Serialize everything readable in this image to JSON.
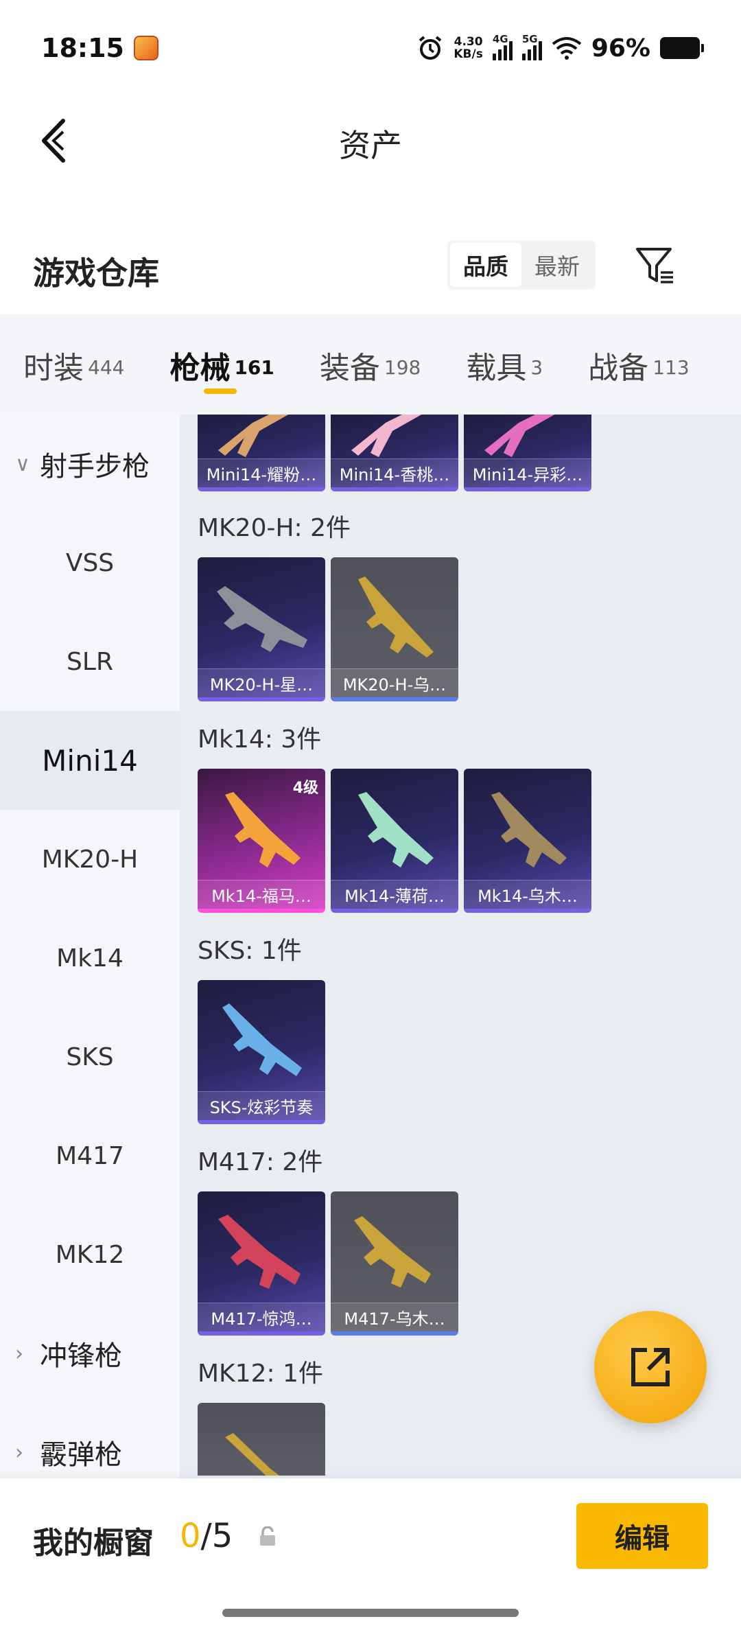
{
  "status": {
    "time": "18:15",
    "speed_value": "4.30",
    "speed_unit": "KB/s",
    "sig1": "4G",
    "sig2": "5G",
    "battery": "96%"
  },
  "nav": {
    "title": "资产"
  },
  "warehouse": {
    "title": "游戏仓库",
    "sort_quality": "品质",
    "sort_latest": "最新"
  },
  "tabs": [
    {
      "name": "时装",
      "count": "444"
    },
    {
      "name": "枪械",
      "count": "161"
    },
    {
      "name": "装备",
      "count": "198"
    },
    {
      "name": "载具",
      "count": "3"
    },
    {
      "name": "战备",
      "count": "113"
    }
  ],
  "sidebar": {
    "group_marksman": "射手步枪",
    "items": [
      "VSS",
      "SLR",
      "Mini14",
      "MK20-H",
      "Mk14",
      "SKS",
      "M417",
      "MK12"
    ],
    "group_smg": "冲锋枪",
    "group_shotgun": "霰弹枪"
  },
  "content": {
    "mini14_cards": [
      "Mini14-耀粉…",
      "Mini14-香桃…",
      "Mini14-异彩…"
    ],
    "mk20_label": "MK20-H: 2件",
    "mk20_cards": [
      "MK20-H-星…",
      "MK20-H-乌…"
    ],
    "mk14_label": "Mk14: 3件",
    "mk14_cards": [
      "Mk14-福马…",
      "Mk14-薄荷…",
      "Mk14-乌木…"
    ],
    "mk14_level": "4级",
    "sks_label": "SKS: 1件",
    "sks_cards": [
      "SKS-炫彩节奏"
    ],
    "m417_label": "M417: 2件",
    "m417_cards": [
      "M417-惊鸿…",
      "M417-乌木…"
    ],
    "mk12_label": "MK12: 1件"
  },
  "bottom": {
    "title": "我的橱窗",
    "count_current": "0",
    "count_total": "/5",
    "edit": "编辑"
  },
  "colors": {
    "accent": "#f7b500",
    "card_purple": "#2c2864",
    "card_grey": "#55565e"
  }
}
